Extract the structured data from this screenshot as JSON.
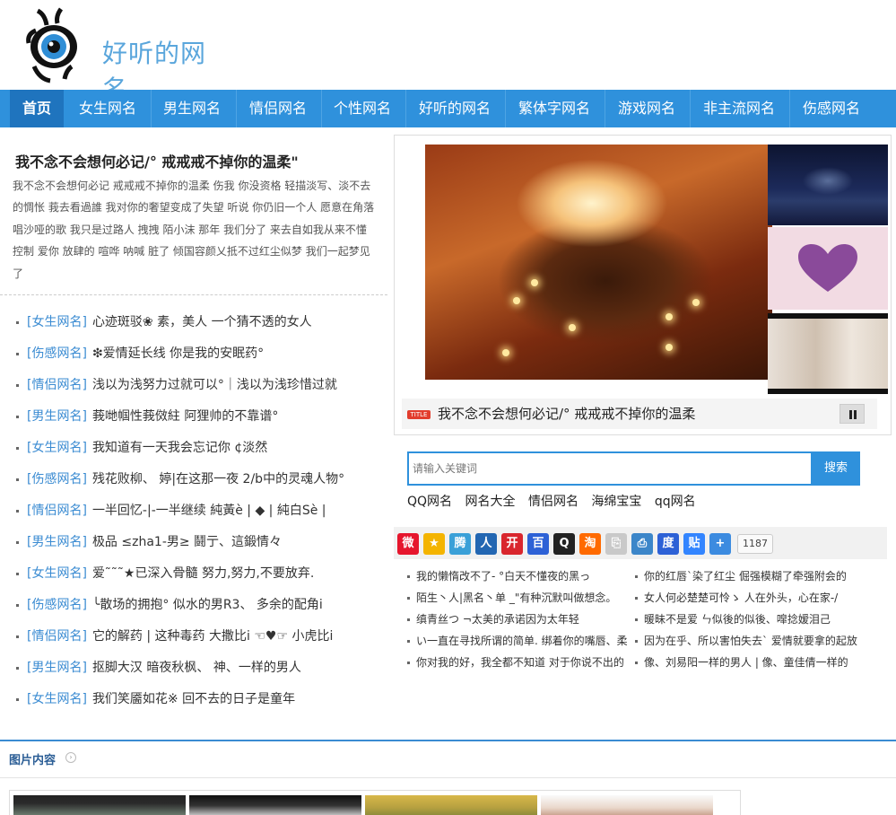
{
  "site": {
    "logo_text": "好听的网名"
  },
  "nav": {
    "items": [
      {
        "label": "首页"
      },
      {
        "label": "女生网名"
      },
      {
        "label": "男生网名"
      },
      {
        "label": "情侣网名"
      },
      {
        "label": "个性网名"
      },
      {
        "label": "好听的网名"
      },
      {
        "label": "繁体字网名"
      },
      {
        "label": "游戏网名"
      },
      {
        "label": "非主流网名"
      },
      {
        "label": "伤感网名"
      }
    ]
  },
  "featured": {
    "title": "我不念不会想何必记/° 戒戒戒不掉你的温柔\"",
    "summary": "我不念不会想何必记 戒戒戒不掉你的温柔 伤我 你没资格 轻描淡写、淡不去的惆怅 莪去看過誰 我对你的奢望变成了失望 听说 你仍旧一个人 愿意在角落唱沙哑的歌 我只是过路人 拽拽 陌小沫 那年 我们分了 来去自如我从来不懂 控制 爱你 放肆的 喧哗 呐喊 脏了 倾国容颜乂抵不过红尘似梦 我们一起梦见了"
  },
  "list": [
    {
      "cat": "[女生网名]",
      "title": "心迹斑驳❀ 素，美人 一个猜不透的女人"
    },
    {
      "cat": "[伤感网名]",
      "title": "❇爱情延长线 你是我的安眠药°"
    },
    {
      "cat": "[情侣网名]",
      "title": "浅以为浅努力过就可以°｜浅以为浅珍惜过就"
    },
    {
      "cat": "[男生网名]",
      "title": "莪哋帼性莪傚紸 阿狸帅的不靠谱°"
    },
    {
      "cat": "[女生网名]",
      "title": "我知道有一天我会忘记你 ¢淡然"
    },
    {
      "cat": "[伤感网名]",
      "title": "残花败柳、 婷|在这那一夜 2/b中的灵魂人物°"
    },
    {
      "cat": "[情侣网名]",
      "title": "一半回忆-|-一半继续 純黃è | ◆ | 純白Sè |"
    },
    {
      "cat": "[男生网名]",
      "title": "极品 ≤zha1-男≥ 鬪亍、這鍛情々"
    },
    {
      "cat": "[女生网名]",
      "title": "爱˜˜˜★已深入骨髓 努力,努力,不要放弃."
    },
    {
      "cat": "[伤感网名]",
      "title": "╰散场的拥抱° 似水的男R3、 多余的配角i"
    },
    {
      "cat": "[情侣网名]",
      "title": "它的解药 | 这种毒药 大撒比i ☜♥☞ 小虎比i"
    },
    {
      "cat": "[男生网名]",
      "title": "抠脚大汉 暗夜秋枫、 神、一样的男人"
    },
    {
      "cat": "[女生网名]",
      "title": "我们笑靥如花※ 回不去的日子是童年"
    }
  ],
  "slideshow": {
    "badge": "TITLE",
    "caption": "我不念不会想何必记/° 戒戒戒不掉你的温柔"
  },
  "search": {
    "placeholder": "请输入关键词",
    "button": "搜索",
    "hot_links": [
      "QQ网名",
      "网名大全",
      "情侣网名",
      "海绵宝宝",
      "qq网名"
    ]
  },
  "share": {
    "icons": [
      {
        "name": "weibo-icon",
        "color": "#e6162d",
        "glyph": "微"
      },
      {
        "name": "qzone-icon",
        "color": "#f4b400",
        "glyph": "★"
      },
      {
        "name": "tencent-weibo-icon",
        "color": "#3aa0d8",
        "glyph": "腾"
      },
      {
        "name": "renren-icon",
        "color": "#2266b2",
        "glyph": "人"
      },
      {
        "name": "kaixin-icon",
        "color": "#d9262d",
        "glyph": "开"
      },
      {
        "name": "baidu-icon",
        "color": "#2d61d6",
        "glyph": "百"
      },
      {
        "name": "qq-icon",
        "color": "#222222",
        "glyph": "Q"
      },
      {
        "name": "taobao-icon",
        "color": "#ff6a00",
        "glyph": "淘"
      },
      {
        "name": "copy-icon",
        "color": "#c9c9c9",
        "glyph": "⎘"
      },
      {
        "name": "print-icon",
        "color": "#3c86c9",
        "glyph": "⎙"
      },
      {
        "name": "baidu-space-icon",
        "color": "#2d61d6",
        "glyph": "度"
      },
      {
        "name": "tieba-icon",
        "color": "#3385ff",
        "glyph": "贴"
      },
      {
        "name": "more-icon",
        "color": "#3c8be0",
        "glyph": "+"
      }
    ],
    "count": "1187"
  },
  "right_list": {
    "col1": [
      "我的懒惰改不了- °白天不懂夜的黑っ",
      "陌生丶人|黑名丶单 _\"有种沉默叫做想念。",
      "缜青丝つ ¬太美的承诺因为太年轻",
      "い一直在寻找所谓的简单. 绑着你的嘴唇、柔",
      "你对我的好，我全都不知道 对于你说不出的"
    ],
    "col2": [
      "你的红唇`染了红尘 倔强模糊了牵强附会的",
      "女人何必楚楚可怜ゝ 人在外头，心在家-/",
      "暖昧不是爱 ㄣ似後的似後、噑捻嫒泪己",
      "因为在乎、所以害怕失去` 爱情就要拿的起放",
      "像、刘易阳一样的男人 | 像、童佳倩一样的"
    ]
  },
  "pictures": {
    "title": "图片内容"
  }
}
